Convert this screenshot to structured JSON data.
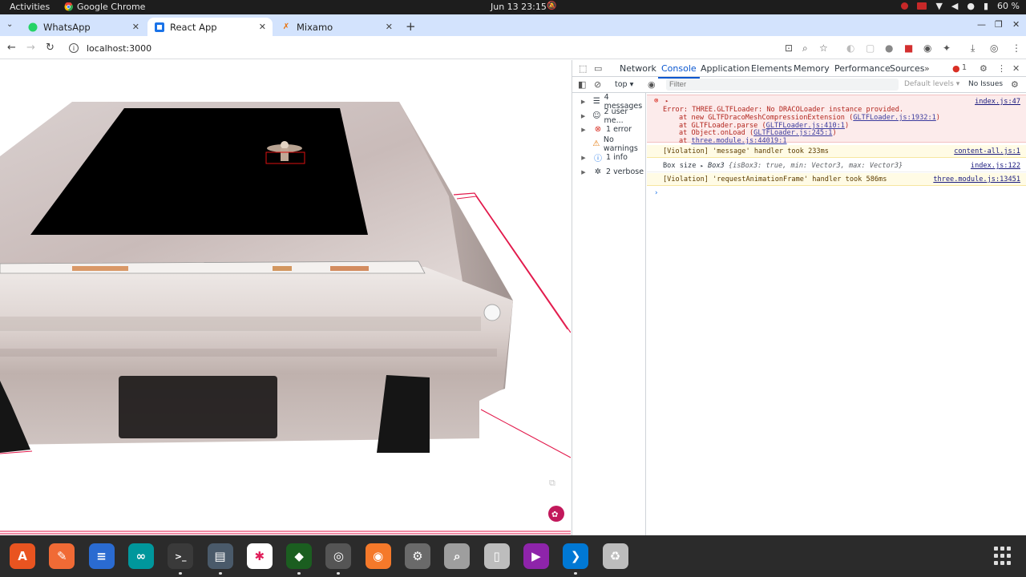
{
  "system_bar": {
    "activities": "Activities",
    "app_name": "Google Chrome",
    "clock": "Jun 13  23:15",
    "battery": "60 %"
  },
  "tabs": [
    {
      "label": "WhatsApp",
      "icon": "whatsapp-icon"
    },
    {
      "label": "React App",
      "icon": "react-icon"
    },
    {
      "label": "Mixamo",
      "icon": "mixamo-icon"
    }
  ],
  "address_bar": {
    "url": "localhost:3000"
  },
  "devtools": {
    "tabs": [
      "Network",
      "Console",
      "Application",
      "Elements",
      "Memory",
      "Performance",
      "Sources"
    ],
    "active_tab": "Console",
    "error_badge": "1",
    "context": "top",
    "filter_placeholder": "Filter",
    "levels": "Default levels",
    "issues": "No Issues",
    "sidebar": [
      {
        "label": "4 messages",
        "icon": "list-icon"
      },
      {
        "label": "2 user me...",
        "icon": "user-icon"
      },
      {
        "label": "1 error",
        "icon": "error-icon"
      },
      {
        "label": "No warnings",
        "icon": "warning-icon"
      },
      {
        "label": "1 info",
        "icon": "info-icon"
      },
      {
        "label": "2 verbose",
        "icon": "bug-icon"
      }
    ],
    "console": {
      "error": {
        "line1": "Error: THREE.GLTFLoader: No DRACOLoader instance provided.",
        "line2_prefix": "at new GLTFDracoMeshCompressionExtension (",
        "line2_link": "GLTFLoader.js:1932:1",
        "line3_prefix": "at GLTFLoader.parse (",
        "line3_link": "GLTFLoader.js:410:1",
        "line4_prefix": "at Object.onLoad (",
        "line4_link": "GLTFLoader.js:245:1",
        "line5_prefix": "at ",
        "line5_link": "three.module.js:44019:1",
        "source": "index.js:47"
      },
      "violation1": {
        "text": "[Violation] 'message' handler took 233ms",
        "source": "content-all.js:1"
      },
      "log": {
        "label": "Box size",
        "type": "Box3",
        "isBox3": "isBox3: true,",
        "min": "min: Vector3,",
        "max": "max: Vector3}",
        "source": "index.js:122"
      },
      "violation2": {
        "text": "[Violation] 'requestAnimationFrame' handler took 586ms",
        "source": "three.module.js:13451"
      }
    }
  },
  "dock_apps": [
    {
      "name": "app-center-icon",
      "color": "#e95420"
    },
    {
      "name": "inkscape-icon",
      "color": "#f06a35"
    },
    {
      "name": "writer-icon",
      "color": "#2a6bd1"
    },
    {
      "name": "arduino-icon",
      "color": "#00979c"
    },
    {
      "name": "terminal-icon",
      "color": "#3a3a3a"
    },
    {
      "name": "files-icon",
      "color": "#4a5a6a"
    },
    {
      "name": "slack-icon",
      "color": "#ffffff"
    },
    {
      "name": "unity-icon",
      "color": "#1b5e20"
    },
    {
      "name": "chrome-icon",
      "color": "#1a73e8"
    },
    {
      "name": "blender-icon",
      "color": "#f5792a"
    },
    {
      "name": "settings-icon",
      "color": "#6a6a6a"
    },
    {
      "name": "image-viewer-icon",
      "color": "#9e9e9e"
    },
    {
      "name": "archive-icon",
      "color": "#bdbdbd"
    },
    {
      "name": "video-icon",
      "color": "#8e24aa"
    },
    {
      "name": "vscode-icon",
      "color": "#0078d4"
    },
    {
      "name": "trash-icon",
      "color": "#bdbdbd"
    }
  ]
}
